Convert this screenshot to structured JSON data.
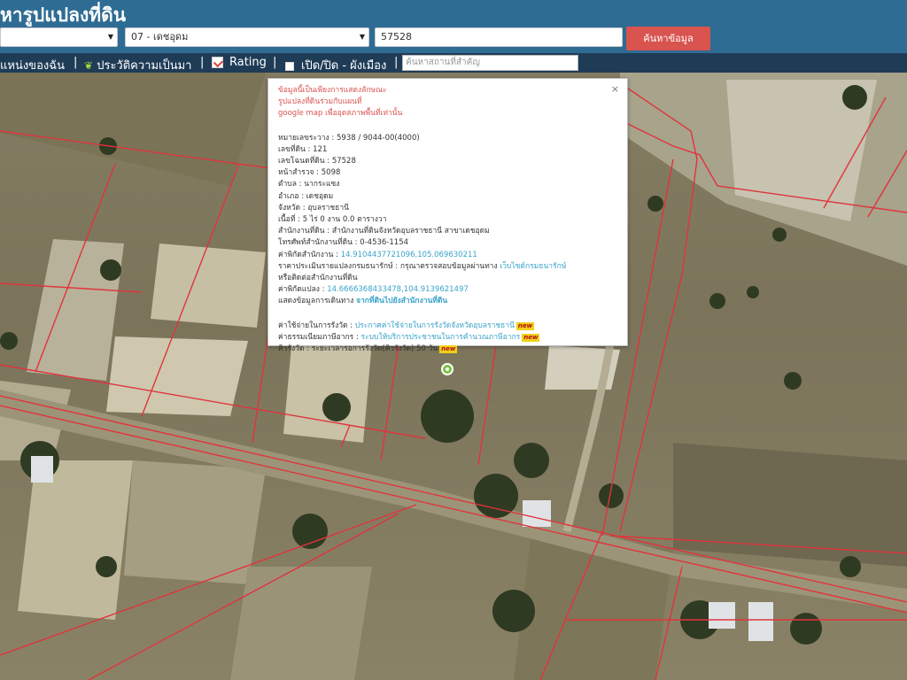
{
  "header": {
    "title": "หารูปแปลงที่ดิน",
    "province_value": "",
    "district_value": "07 - เดชอุดม",
    "parcel_value": "57528",
    "search_label": "ค้นหาข้อมูล"
  },
  "menu": {
    "location_label": "แหน่งของฉัน",
    "history_label": "ประวัติความเป็นมา",
    "rating_label": "Rating",
    "toggle_label": "เปิด/ปิด - ผังเมือง",
    "place_search_placeholder": "ค้นหาสถานที่สำคัญ",
    "separator": "|"
  },
  "popup": {
    "close": "×",
    "notice": [
      "ข้อมูลนี้เป็นเพียงการแสดงลักษณะ",
      "รูปแปลงที่ดินร่วมกับแผนที่",
      "google map เพื่ออุดสภาพพื้นที่เท่านั้น"
    ],
    "fields": [
      {
        "label": "หมายเลขระวาง",
        "value": "5938 / 9044-00(4000)"
      },
      {
        "label": "เลขที่ดิน",
        "value": "121"
      },
      {
        "label": "เลขโฉนดที่ดิน",
        "value": "57528"
      },
      {
        "label": "หน้าสำรวจ",
        "value": "5098"
      },
      {
        "label": "ตำบล",
        "value": "นากระแซง"
      },
      {
        "label": "อำเภอ",
        "value": "เดชอุดม"
      },
      {
        "label": "จังหวัด",
        "value": "อุบลราชธานี"
      },
      {
        "label": "เนื้อที่",
        "value": "5 ไร่ 0 งาน 0.0 ตารางวา"
      },
      {
        "label": "สำนักงานที่ดิน",
        "value": "สำนักงานที่ดินจังหวัดอุบลราชธานี สาขาเดชอุดม"
      },
      {
        "label": "โทรศัพท์สำนักงานที่ดิน",
        "value": "0-4536-1154"
      }
    ],
    "office_coord_label": "ค่าพิกัดสำนักงาน",
    "office_coord_value": "14.9104437721096,105.069630211",
    "appraisal_label": "ราคาประเมินรายแปลงกรมธนารักษ์",
    "appraisal_text": "กรุณาตรวจสอบข้อมูลผ่านทาง",
    "appraisal_link": "เว็บไซต์กรมธนารักษ์",
    "appraisal_text2": "หรือติดต่อสำนักงานที่ดิน",
    "parcel_coord_label": "ค่าพิกัดแปลง",
    "parcel_coord_value": "14.6666368433478,104.9139621497",
    "route_label": "แสดงข้อมูลการเดินทาง",
    "route_link": "จากที่ดินไปยังสำนักงานที่ดิน",
    "fee_label": "ค่าใช้จ่ายในการรังวัด",
    "fee_link": "ประกาศค่าใช้จ่ายในการรังวัดจังหวัดอุบลราชธานี",
    "tax_label": "ค่าธรรมเนียมภาษีอากร",
    "tax_link": "ระบบให้บริการประชาชนในการคำนวณภาษีอากร",
    "queue_label": "คิวรังวัด",
    "queue_value": "ระยะเวลารอการรังวัด(คิวรังวัด) 50 วัน",
    "new_badge": "new"
  }
}
